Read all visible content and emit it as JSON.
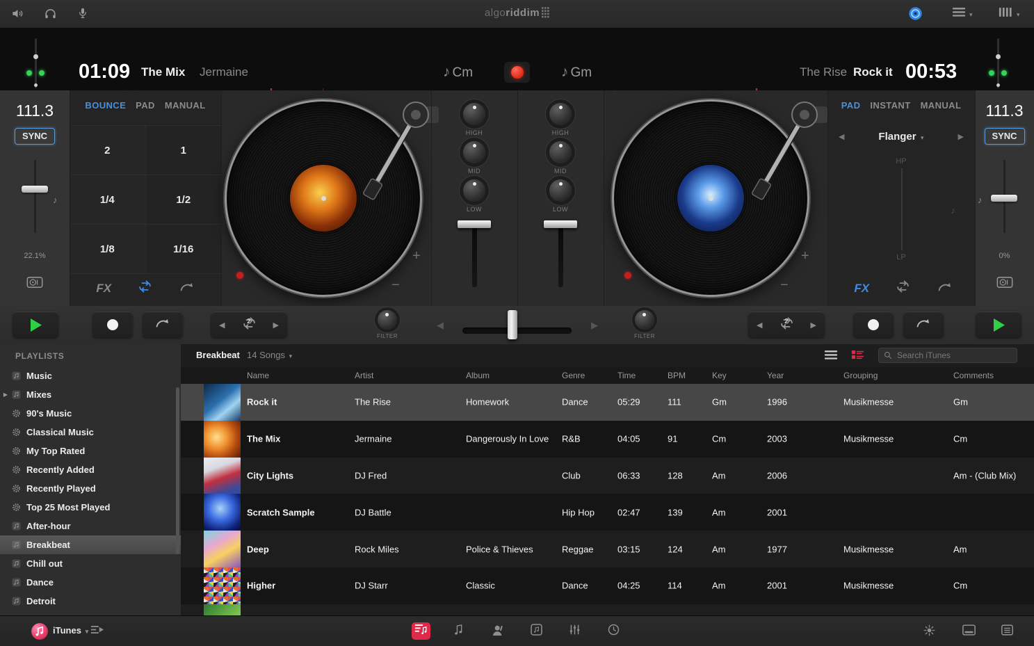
{
  "window": {
    "logo_prefix": "algo",
    "logo_suffix": "riddim"
  },
  "colors": {
    "accent_blue": "#4a90d9",
    "record_red": "#e02818",
    "play_green": "#2fd045",
    "active_pink": "#e0294a",
    "led_green": "#35d158"
  },
  "decks": {
    "left": {
      "time": "01:09",
      "title": "The Mix",
      "artist": "Jermaine",
      "key": "Cm",
      "bpm": "111.3",
      "sync_label": "SYNC",
      "tempo_percent": "22.1%",
      "tabs": [
        "BOUNCE",
        "PAD",
        "MANUAL"
      ],
      "active_tab": "BOUNCE",
      "pads": [
        "2",
        "1",
        "1/4",
        "1/2",
        "1/8",
        "1/16"
      ],
      "fx_label": "FX",
      "loop_length": "2",
      "pitch_plus": "+",
      "pitch_minus": "−"
    },
    "right": {
      "time": "00:53",
      "title": "Rock it",
      "artist": "The Rise",
      "key": "Gm",
      "bpm": "111.3",
      "sync_label": "SYNC",
      "tempo_percent": "0%",
      "tabs": [
        "PAD",
        "INSTANT",
        "MANUAL"
      ],
      "active_tab": "PAD",
      "fx_name": "Flanger",
      "filter_hp": "HP",
      "filter_lp": "LP",
      "fx_label": "FX",
      "loop_length": "2",
      "pitch_plus": "+",
      "pitch_minus": "−"
    }
  },
  "mixer": {
    "eq_labels": [
      "HIGH",
      "MID",
      "LOW"
    ],
    "filter_label": "FILTER"
  },
  "waveform": {
    "palette": [
      "#46b4e8",
      "#58d878",
      "#e8e060",
      "#d8d8d8",
      "#62dcc8"
    ],
    "playhead_color": "#e03028",
    "left_playhead": 0.505,
    "left_cue": 0.63,
    "right_playhead": 0.49
  },
  "turntables": {
    "left_label_art": "radial-gradient(circle at 45% 42%, #f8d050 0%, #e07818 32%, #8a3008 62%, #2a0e02 100%)",
    "right_label_art": "radial-gradient(circle at 50% 45%, #d8ecff 0%, #5a9ae8 26%, #1a3a8a 58%, #070c28 100%)"
  },
  "library": {
    "sidebar_title": "PLAYLISTS",
    "playlists": [
      {
        "label": "Music",
        "icon": "playlist"
      },
      {
        "label": "Mixes",
        "icon": "playlist",
        "disclosure": true
      },
      {
        "label": "90's Music",
        "icon": "smart"
      },
      {
        "label": "Classical Music",
        "icon": "smart"
      },
      {
        "label": "My Top Rated",
        "icon": "smart"
      },
      {
        "label": "Recently Added",
        "icon": "smart"
      },
      {
        "label": "Recently Played",
        "icon": "smart"
      },
      {
        "label": "Top 25 Most Played",
        "icon": "smart"
      },
      {
        "label": "After-hour",
        "icon": "playlist"
      },
      {
        "label": "Breakbeat",
        "icon": "playlist",
        "selected": true
      },
      {
        "label": "Chill out",
        "icon": "playlist"
      },
      {
        "label": "Dance",
        "icon": "playlist"
      },
      {
        "label": "Detroit",
        "icon": "playlist"
      }
    ],
    "header": {
      "playlist_name": "Breakbeat",
      "song_count": "14 Songs",
      "search_placeholder": "Search iTunes"
    },
    "columns": [
      "Name",
      "Artist",
      "Album",
      "Genre",
      "Time",
      "BPM",
      "Key",
      "Year",
      "Grouping",
      "Comments"
    ],
    "rows": [
      {
        "art": "linear-gradient(140deg,#0e2a4a 0%,#2b6fae 45%,#9fd4f2 68%,#163a63 100%)",
        "name": "Rock it",
        "artist": "The Rise",
        "album": "Homework",
        "genre": "Dance",
        "time": "05:29",
        "bpm": "111",
        "key": "Gm",
        "year": "1996",
        "grouping": "Musikmesse",
        "comments": "Gm",
        "selected": true
      },
      {
        "art": "radial-gradient(circle at 35% 45%,#ffe08a 0%,#f09030 35%,#b34a10 65%,#5a1a05 100%)",
        "name": "The Mix",
        "artist": "Jermaine",
        "album": "Dangerously In Love",
        "genre": "R&B",
        "time": "04:05",
        "bpm": "91",
        "key": "Cm",
        "year": "2003",
        "grouping": "Musikmesse",
        "comments": "Cm"
      },
      {
        "art": "linear-gradient(160deg,#ececf2 0%,#d8d8e0 30%,#c03040 55%,#3a4a9a 85%)",
        "name": "City Lights",
        "artist": "DJ Fred",
        "album": "",
        "genre": "Club",
        "time": "06:33",
        "bpm": "128",
        "key": "Am",
        "year": "2006",
        "grouping": "",
        "comments": "Am - (Club Mix)"
      },
      {
        "art": "radial-gradient(circle at 45% 40%,#a8d4f8 0%,#3a6ae0 40%,#10237a 75%,#060d3a 100%)",
        "name": "Scratch Sample",
        "artist": "DJ Battle",
        "album": "",
        "genre": "Hip Hop",
        "time": "02:47",
        "bpm": "139",
        "key": "Am",
        "year": "2001",
        "grouping": "",
        "comments": ""
      },
      {
        "art": "linear-gradient(150deg,#7ad4e0 0%,#e8a8d0 35%,#f8d060 60%,#8a55c0 100%)",
        "name": "Deep",
        "artist": "Rock Miles",
        "album": "Police & Thieves",
        "genre": "Reggae",
        "time": "03:15",
        "bpm": "124",
        "key": "Am",
        "year": "1977",
        "grouping": "Musikmesse",
        "comments": "Am"
      },
      {
        "art": "repeating-conic-gradient(#e05050 0% 12%,#3050d0 12% 24%,#f0d040 24% 36%,#40c0a0 36% 48%,#a040c0 48% 60%,#202020 60% 72%,#e8e8e8 72% 84%,#e07030 84% 100%)",
        "art_size": "14px 14px",
        "name": "Higher",
        "artist": "DJ Starr",
        "album": "Classic",
        "genre": "Dance",
        "time": "04:25",
        "bpm": "114",
        "key": "Am",
        "year": "2001",
        "grouping": "Musikmesse",
        "comments": "Cm"
      },
      {
        "art": "linear-gradient(135deg,#2f7a33 0%,#7ec14e 60%,#bede7a 100%)",
        "name": "",
        "artist": "",
        "album": "",
        "genre": "",
        "time": "",
        "bpm": "",
        "key": "",
        "year": "",
        "grouping": "",
        "comments": "",
        "partial": true
      }
    ]
  },
  "toolbar": {
    "source_label": "iTunes"
  }
}
